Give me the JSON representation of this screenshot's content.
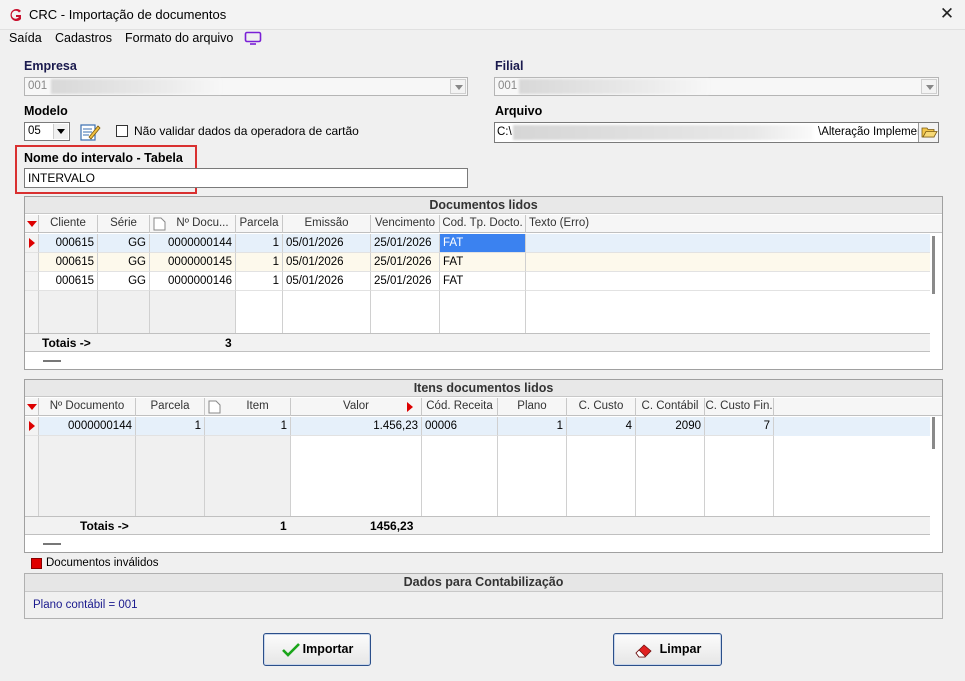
{
  "window": {
    "title": "CRC - Importação de documentos",
    "close": "✕"
  },
  "menu": {
    "items": [
      "Saída",
      "Cadastros",
      "Formato do arquivo"
    ]
  },
  "form": {
    "empresa_label": "Empresa",
    "empresa_value": "001",
    "filial_label": "Filial",
    "filial_value": "001",
    "modelo_label": "Modelo",
    "modelo_value": "05",
    "nao_validar_label": "Não validar dados da operadora de cartão",
    "arquivo_label": "Arquivo",
    "arquivo_prefix": "C:\\",
    "arquivo_suffix": "\\Alteração Implemen",
    "intervalo_label": "Nome do intervalo - Tabela",
    "intervalo_value": "INTERVALO"
  },
  "docs": {
    "title": "Documentos lidos",
    "columns": [
      "Cliente",
      "Série",
      "Nº Docu...",
      "Parcela",
      "Emissão",
      "Vencimento",
      "Cod. Tp. Docto.",
      "Texto (Erro)"
    ],
    "rows": [
      [
        "000615",
        "GG",
        "0000000144",
        "1",
        "05/01/2026",
        "25/01/2026",
        "FAT",
        ""
      ],
      [
        "000615",
        "GG",
        "0000000145",
        "1",
        "05/01/2026",
        "25/01/2026",
        "FAT",
        ""
      ],
      [
        "000615",
        "GG",
        "0000000146",
        "1",
        "05/01/2026",
        "25/01/2026",
        "FAT",
        ""
      ]
    ],
    "totals_label": "Totais ->",
    "totals_count": "3"
  },
  "itens": {
    "title": "Itens documentos lidos",
    "columns": [
      "Nº Documento",
      "Parcela",
      "Item",
      "Valor",
      "Cód. Receita",
      "Plano",
      "C. Custo",
      "C. Contábil",
      "C. Custo Fin."
    ],
    "rows": [
      [
        "0000000144",
        "1",
        "1",
        "1.456,23",
        "00006",
        "1",
        "4",
        "2090",
        "7"
      ]
    ],
    "totals_label": "Totais ->",
    "totals_count": "1",
    "totals_valor": "1456,23"
  },
  "legend": {
    "invalid_label": "Documentos inválidos",
    "invalid_color": "#e00000"
  },
  "contab": {
    "title": "Dados para Contabilização",
    "plano_text": "Plano contábil = 001"
  },
  "buttons": {
    "importar": "Importar",
    "limpar": "Limpar"
  },
  "colors": {
    "highlight": "#3b82f0",
    "label_blue": "#1a1a4e",
    "red_frame": "#d93030"
  }
}
